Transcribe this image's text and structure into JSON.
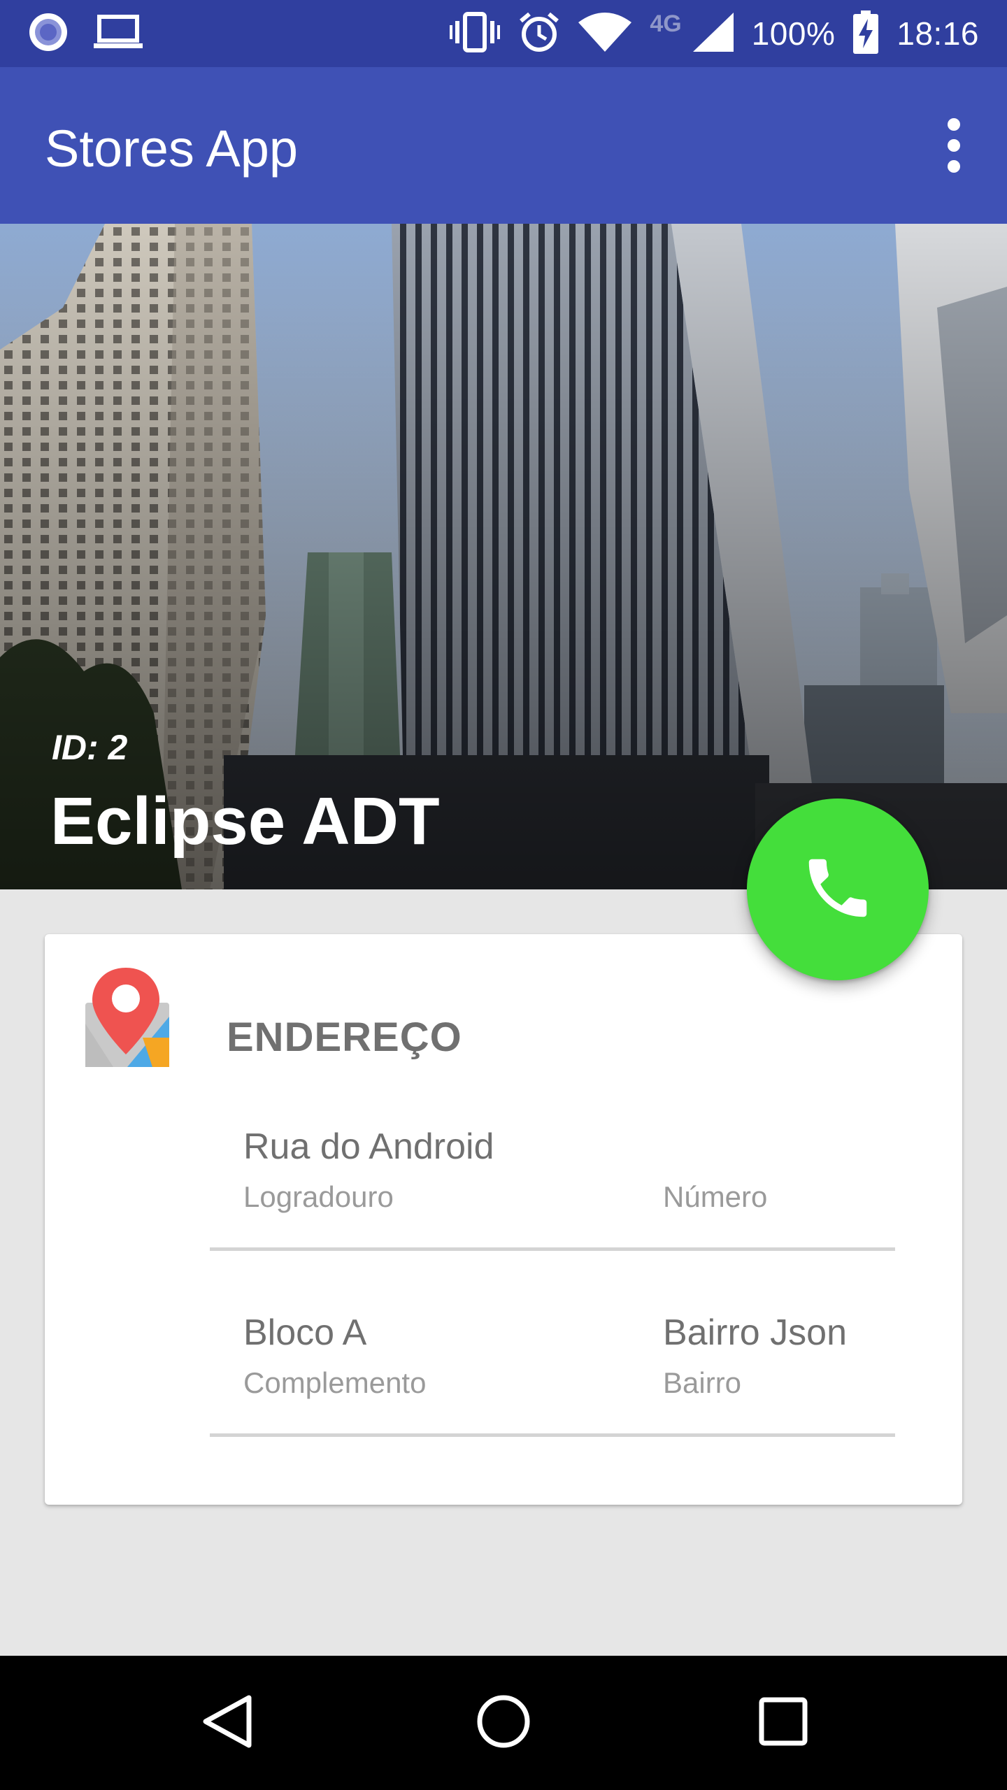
{
  "status_bar": {
    "network_type": "4G",
    "battery": "100%",
    "time": "18:16"
  },
  "app_bar": {
    "title": "Stores App"
  },
  "store": {
    "id_label": "ID: 2",
    "name": "Eclipse ADT"
  },
  "address": {
    "section_title": "ENDEREÇO",
    "fields": [
      {
        "value": "Rua do Android",
        "label": "Logradouro"
      },
      {
        "value": "",
        "label": "Número"
      },
      {
        "value": "Bloco A",
        "label": "Complemento"
      },
      {
        "value": "Bairro Json",
        "label": "Bairro"
      }
    ]
  },
  "colors": {
    "status_bar": "#303f9f",
    "app_bar": "#3f51b5",
    "fab": "#44de3b",
    "background": "#e6e6e6"
  },
  "icons": {
    "fab": "phone-icon",
    "section": "map-pin-icon",
    "menu": "more-vert-icon"
  }
}
